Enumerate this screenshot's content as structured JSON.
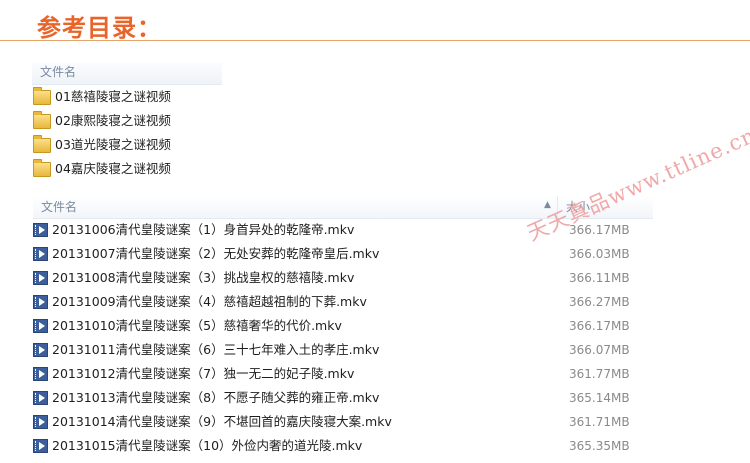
{
  "page": {
    "title": "参考目录："
  },
  "folders": {
    "header": "文件名",
    "items": [
      {
        "name": "01慈禧陵寝之谜视频"
      },
      {
        "name": "02康熙陵寝之谜视频"
      },
      {
        "name": "03道光陵寝之谜视频"
      },
      {
        "name": "04嘉庆陵寝之谜视频"
      }
    ]
  },
  "files": {
    "name_header": "文件名",
    "size_header": "大小",
    "sort_indicator": "▲",
    "items": [
      {
        "name": "20131006清代皇陵谜案（1）身首异处的乾隆帝.mkv",
        "size": "366.17MB"
      },
      {
        "name": "20131007清代皇陵谜案（2）无处安葬的乾隆帝皇后.mkv",
        "size": "366.03MB"
      },
      {
        "name": "20131008清代皇陵谜案（3）挑战皇权的慈禧陵.mkv",
        "size": "366.11MB"
      },
      {
        "name": "20131009清代皇陵谜案（4）慈禧超越祖制的下葬.mkv",
        "size": "366.27MB"
      },
      {
        "name": "20131010清代皇陵谜案（5）慈禧奢华的代价.mkv",
        "size": "366.17MB"
      },
      {
        "name": "20131011清代皇陵谜案（6）三十七年难入土的孝庄.mkv",
        "size": "366.07MB"
      },
      {
        "name": "20131012清代皇陵谜案（7）独一无二的妃子陵.mkv",
        "size": "361.77MB"
      },
      {
        "name": "20131013清代皇陵谜案（8）不愿子随父葬的雍正帝.mkv",
        "size": "365.14MB"
      },
      {
        "name": "20131014清代皇陵谜案（9）不堪回首的嘉庆陵寝大案.mkv",
        "size": "361.71MB"
      },
      {
        "name": "20131015清代皇陵谜案（10）外俭内奢的道光陵.mkv",
        "size": "365.35MB"
      }
    ]
  },
  "watermark": {
    "text": "天天真品www.ttline.cn"
  },
  "colors": {
    "title": "#e8642a",
    "rule": "#e6a36a",
    "watermark": "#f0a8a8"
  }
}
